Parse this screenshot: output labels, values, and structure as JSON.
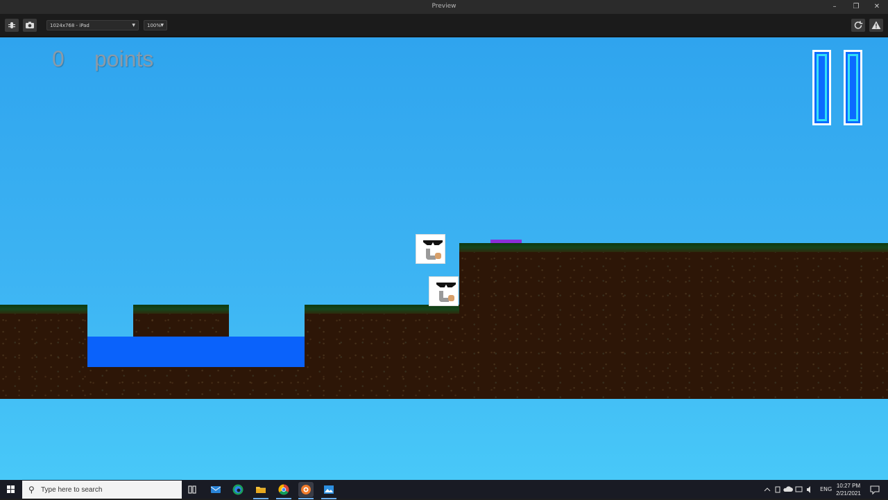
{
  "window": {
    "title": "Preview"
  },
  "toolbar": {
    "device": "1024x768 - iPad",
    "zoom": "100%"
  },
  "game": {
    "score_value": "0",
    "score_label": "points"
  },
  "taskbar": {
    "search_placeholder": "Type here to search",
    "language": "ENG",
    "time": "10:27 PM",
    "date": "2/21/2021"
  }
}
